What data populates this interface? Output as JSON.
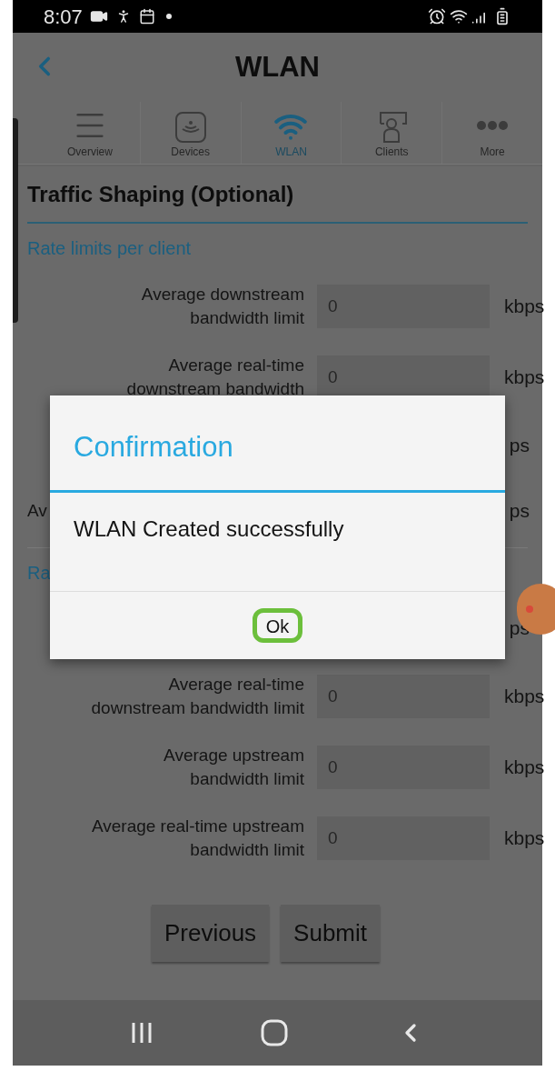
{
  "status_bar": {
    "time": "8:07"
  },
  "header": {
    "title": "WLAN"
  },
  "tabs": [
    {
      "label": "Overview",
      "selected": false
    },
    {
      "label": "Devices",
      "selected": false
    },
    {
      "label": "WLAN",
      "selected": true
    },
    {
      "label": "Clients",
      "selected": false
    },
    {
      "label": "More",
      "selected": false
    }
  ],
  "section": {
    "title": "Traffic Shaping (Optional)"
  },
  "groups": [
    {
      "title": "Rate limits per client",
      "rows": [
        {
          "kind": "field",
          "label": "Average downstream bandwidth limit",
          "value": "0",
          "unit": "kbps"
        },
        {
          "kind": "field",
          "label": "Average real-time downstream bandwidth",
          "value": "0",
          "unit": "kbps"
        },
        {
          "kind": "partial",
          "unit": "ps"
        },
        {
          "kind": "partial",
          "label": "Av",
          "unit": "ps"
        }
      ]
    },
    {
      "title": "Ra",
      "rows": [
        {
          "kind": "partial",
          "unit": "ps"
        },
        {
          "kind": "field",
          "label": "Average real-time downstream bandwidth limit",
          "value": "0",
          "unit": "kbps"
        },
        {
          "kind": "field",
          "label": "Average upstream bandwidth limit",
          "value": "0",
          "unit": "kbps"
        },
        {
          "kind": "field",
          "label": "Average real-time upstream bandwidth limit",
          "value": "0",
          "unit": "kbps"
        }
      ]
    }
  ],
  "buttons": [
    "Previous",
    "Submit"
  ],
  "dialog": {
    "title": "Confirmation",
    "message": "WLAN Created successfully",
    "button": "Ok",
    "highlighted": true
  }
}
